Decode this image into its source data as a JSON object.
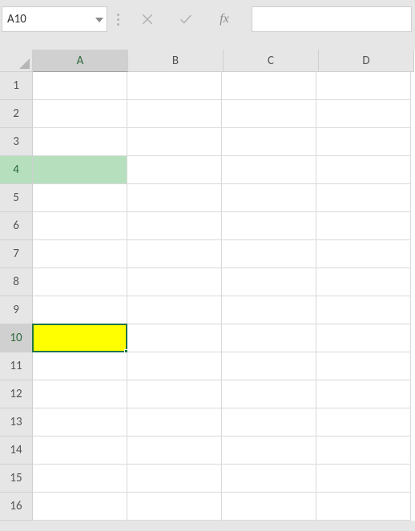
{
  "formula_bar": {
    "name_box_value": "A10",
    "formula_value": "",
    "fx_label": "fx"
  },
  "columns": [
    "A",
    "B",
    "C",
    "D"
  ],
  "rows": [
    "1",
    "2",
    "3",
    "4",
    "5",
    "6",
    "7",
    "8",
    "9",
    "10",
    "11",
    "12",
    "13",
    "14",
    "15",
    "16"
  ],
  "active_cell": "A10",
  "highlight_row": "4",
  "active_cell_fill": "#ffff00",
  "highlight_fill": "#b6dfbd"
}
